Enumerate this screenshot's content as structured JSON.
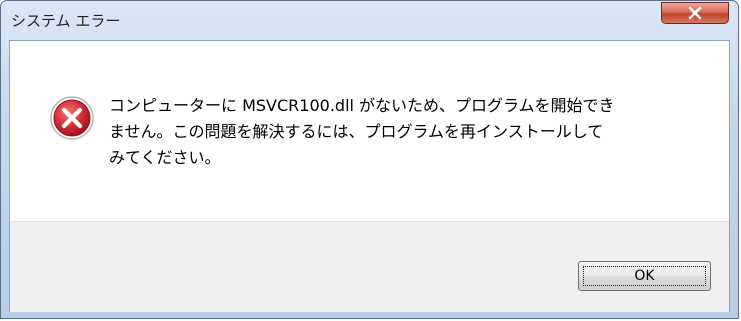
{
  "window": {
    "title": "システム エラー"
  },
  "titlebar": {
    "close_icon": "close-icon"
  },
  "dialog": {
    "icon": "error-icon",
    "message_lines": [
      "コンピューターに MSVCR100.dll がないため、プログラムを開始でき",
      "ません。この問題を解決するには、プログラムを再インストールして",
      "みてください。"
    ],
    "ok_label": "OK"
  },
  "colors": {
    "close_button": "#c2422b",
    "error_icon": "#c8252b",
    "frame": "#c5d7ee"
  }
}
